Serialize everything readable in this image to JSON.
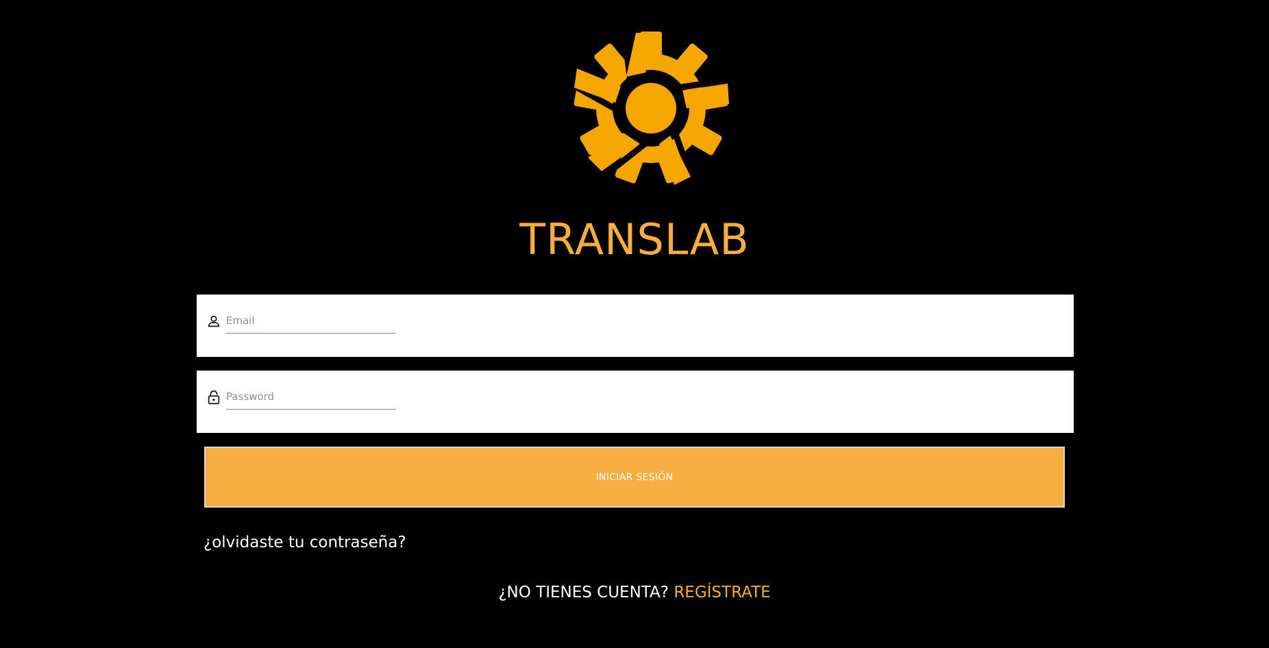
{
  "brand": {
    "logo_icon": "gear-logo-icon",
    "name": "TRANSLAB",
    "accent_color": "#F7AE3B"
  },
  "login_form": {
    "email": {
      "icon": "user-icon",
      "placeholder": "Email",
      "value": ""
    },
    "password": {
      "icon": "lock-icon",
      "placeholder": "Password",
      "value": ""
    },
    "submit_label": "INICIAR SESIÓN",
    "submit_color": "#F7AE40",
    "forgot_password_label": "¿olvidaste tu contraseña?"
  },
  "register": {
    "prompt": "¿NO TIENES CUENTA?",
    "link_label": "REGÍSTRATE",
    "link_color": "#F7B21E"
  }
}
